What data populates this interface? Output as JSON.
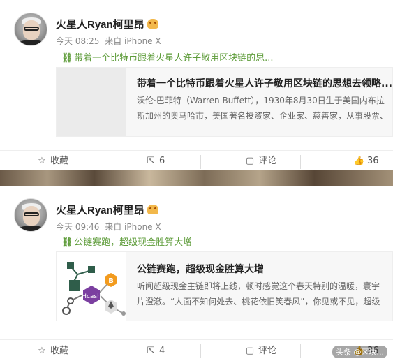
{
  "posts": [
    {
      "author": "火星人Ryan柯里昂",
      "time": "今天 08:25",
      "source": "来自 iPhone X",
      "link_text": "带着一个比特币跟着火星人许子敬用区块链的思...",
      "card": {
        "title": "带着一个比特币跟着火星人许子敬用区块链的思想去领略...",
        "desc": "沃伦·巴菲特（Warren Buffett），1930年8月30日生于美国内布拉斯加州的奥马哈市，美国著名投资家、企业家、慈善家，从事股票、电"
      },
      "actions": {
        "favorite": "收藏",
        "repost": "6",
        "comment": "评论",
        "like": "36"
      }
    },
    {
      "author": "火星人Ryan柯里昂",
      "time": "今天 09:46",
      "source": "来自 iPhone X",
      "link_text": "公链赛跑，超级现金胜算大增",
      "card": {
        "title": "公链赛跑，超级现金胜算大增",
        "desc": "听闻超级现金主链即将上线，顿时感觉这个春天特别的温暖，寰宇一片澄澈。“人面不知何处去、桃花依旧笑春风”，你见或不见，超级现金",
        "diagram_labels": [
          "B",
          "Hcash"
        ]
      },
      "actions": {
        "favorite": "收藏",
        "repost": "4",
        "comment": "评论",
        "like": "36"
      }
    }
  ],
  "watermark": "头条 @区块..."
}
